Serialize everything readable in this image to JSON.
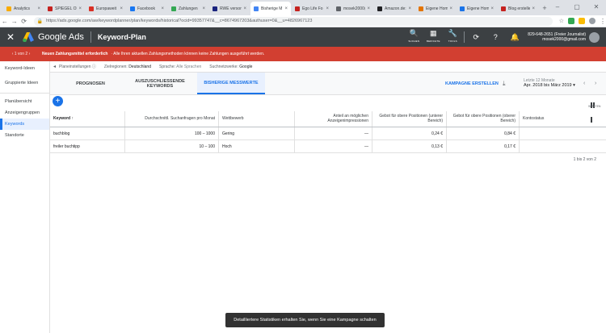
{
  "browser": {
    "tabs": [
      {
        "label": "Analytics",
        "color": "#f9ab00"
      },
      {
        "label": "SPIEGEL ON",
        "color": "#c5221f"
      },
      {
        "label": "Europaweit",
        "color": "#d93025"
      },
      {
        "label": "Facebook",
        "color": "#1877f2"
      },
      {
        "label": "Zahlungen",
        "color": "#34a853"
      },
      {
        "label": "RWE versorg",
        "color": "#1a237e"
      },
      {
        "label": "Bisherige M",
        "color": "#4285f4",
        "active": true
      },
      {
        "label": "Ego Life Fo",
        "color": "#c5221f"
      },
      {
        "label": "mosek2000@",
        "color": "#5f6368"
      },
      {
        "label": "Amazon.de:",
        "color": "#202124"
      },
      {
        "label": "Eigene Hom",
        "color": "#e37400"
      },
      {
        "label": "Eigene Hom",
        "color": "#1a73e8"
      },
      {
        "label": "Blog erstelle",
        "color": "#c5221f"
      }
    ],
    "new_tab": "+",
    "url": "https://ads.google.com/aw/keywordplanner/plan/keywords/historical?ocid=99357747&__c=8674967203&authuser=0&__u=4826967123",
    "window_controls": [
      "–",
      "▢",
      "✕"
    ]
  },
  "header": {
    "close": "✕",
    "brand": "Google Ads",
    "page_title": "Keyword-Plan",
    "icons": [
      {
        "glyph": "🔍",
        "label": "SUCHEN"
      },
      {
        "glyph": "▦",
        "label": "BERICHTE"
      },
      {
        "glyph": "🔧",
        "label": "TOOLS"
      }
    ],
    "refresh": "⟳",
    "help": "?",
    "bell": "🔔",
    "account_line1": "829-648-2651 (Freier Journalist)",
    "account_line2": "mosek2000@gmail.com"
  },
  "banner": {
    "pager": "‹  1 von 2  ›",
    "bold": "Neuen Zahlungsmittel erforderlich",
    "text": "· Alle Ihren aktuellen Zahlungsmethoden können keine Zahlungen ausgeführt werden."
  },
  "leftnav": {
    "items": [
      "Keyword-Ideen",
      "Gruppierte Ideen"
    ],
    "items2": [
      "Planübersicht",
      "Anzeigengruppen",
      "Keywords",
      "Standorte"
    ],
    "active": "Keywords"
  },
  "settings": {
    "label": "Planeinstellungen",
    "items": [
      {
        "key": "Zielregionen:",
        "value": "Deutschland"
      },
      {
        "key": "Sprache:",
        "value": "Alle Sprachen"
      },
      {
        "key": "Suchnetzwerke:",
        "value": "Google"
      }
    ]
  },
  "tabs": {
    "t1": "PROGNOSEN",
    "t2": "AUSZUSCHLIESSENDE KEYWORDS",
    "t3": "BISHERIGE MESSWERTE",
    "campaign": "KAMPAGNE ERSTELLEN",
    "date_label": "Letzte 12 Monate",
    "date_value": "Apr. 2018 bis März 2019  ▾",
    "prev": "‹",
    "next": "›"
  },
  "columns_label": "SPALTEN",
  "table": {
    "headers": [
      "Keyword ↑",
      "Durchschnittl. Suchanfragen pro Monat",
      "Wettbewerb",
      "Anteil an möglichen Anzeigenimpressionen",
      "Gebot für obere Positionen (unterer Bereich)",
      "Gebot für obere Positionen (oberer Bereich)",
      "Kontostatus"
    ],
    "rows": [
      [
        "buchblog",
        "100 – 1000",
        "Gering",
        "—",
        "0,24 €",
        "0,84 €",
        ""
      ],
      [
        "freiler buchtipp",
        "10 – 100",
        "Hoch",
        "—",
        "0,13 €",
        "0,17 €",
        ""
      ]
    ],
    "pager": "1 bis 2 von 2"
  },
  "toast": "Detailliertere Statistiken erhalten Sie, wenn Sie eine Kampagne schalten"
}
